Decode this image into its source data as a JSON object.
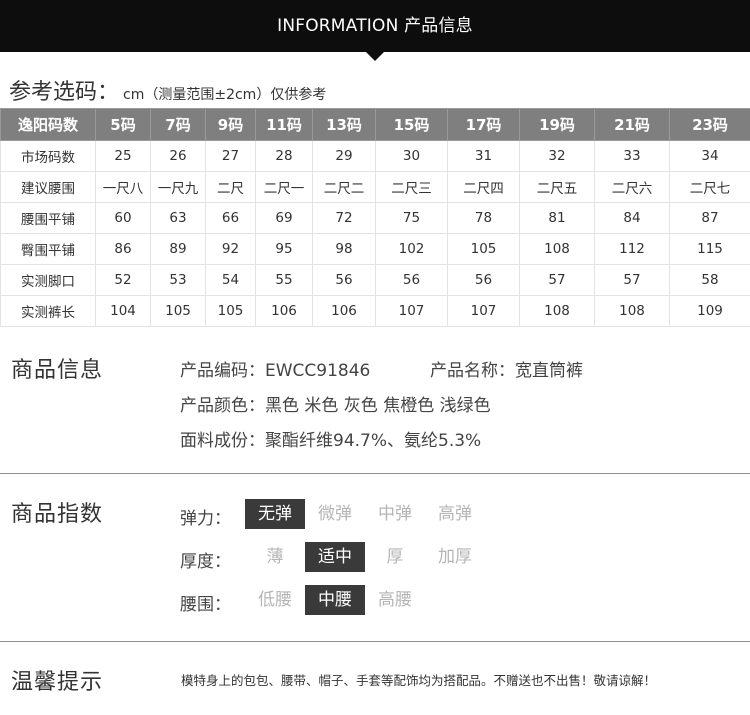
{
  "banner": {
    "title": "INFORMATION 产品信息"
  },
  "size_reference": {
    "heading": "参考选码：",
    "note": "cm（测量范围±2cm）仅供参考",
    "header_row": [
      "逸阳码数",
      "5码",
      "7码",
      "9码",
      "11码",
      "13码",
      "15码",
      "17码",
      "19码",
      "21码",
      "23码"
    ],
    "rows": [
      [
        "市场码数",
        "25",
        "26",
        "27",
        "28",
        "29",
        "30",
        "31",
        "32",
        "33",
        "34"
      ],
      [
        "建议腰围",
        "一尺八",
        "一尺九",
        "二尺",
        "二尺一",
        "二尺二",
        "二尺三",
        "二尺四",
        "二尺五",
        "二尺六",
        "二尺七"
      ],
      [
        "腰围平铺",
        "60",
        "63",
        "66",
        "69",
        "72",
        "75",
        "78",
        "81",
        "84",
        "87"
      ],
      [
        "臀围平铺",
        "86",
        "89",
        "92",
        "95",
        "98",
        "102",
        "105",
        "108",
        "112",
        "115"
      ],
      [
        "实测脚口",
        "52",
        "53",
        "54",
        "55",
        "56",
        "56",
        "56",
        "57",
        "57",
        "58"
      ],
      [
        "实测裤长",
        "104",
        "105",
        "105",
        "106",
        "106",
        "107",
        "107",
        "108",
        "108",
        "109"
      ]
    ]
  },
  "product_info": {
    "title": "商品信息",
    "code": "产品编码：EWCC91846",
    "name": "产品名称：宽直筒裤",
    "colors": "产品颜色：黑色 米色 灰色 焦橙色 浅绿色",
    "fabric": "面料成份：聚酯纤维94.7%、氨纶5.3%"
  },
  "product_index": {
    "title": "商品指数",
    "elasticity": {
      "label": "弹力：",
      "options": [
        "无弹",
        "微弹",
        "中弹",
        "高弹"
      ],
      "selected": "无弹"
    },
    "thickness": {
      "label": "厚度：",
      "options": [
        "薄",
        "适中",
        "厚",
        "加厚"
      ],
      "selected": "适中"
    },
    "waist": {
      "label": "腰围：",
      "options": [
        "低腰",
        "中腰",
        "高腰"
      ],
      "selected": "中腰"
    }
  },
  "tips": {
    "title": "温馨提示",
    "text": "模特身上的包包、腰带、帽子、手套等配饰均为搭配品。不赠送也不出售！敬请谅解！"
  },
  "colors": {
    "banner_bg": "#0d0d0d",
    "table_header_bg": "#7f7f7f",
    "chip_active_bg": "#3a3a3a",
    "chip_inactive_text": "#b5b5b5"
  }
}
